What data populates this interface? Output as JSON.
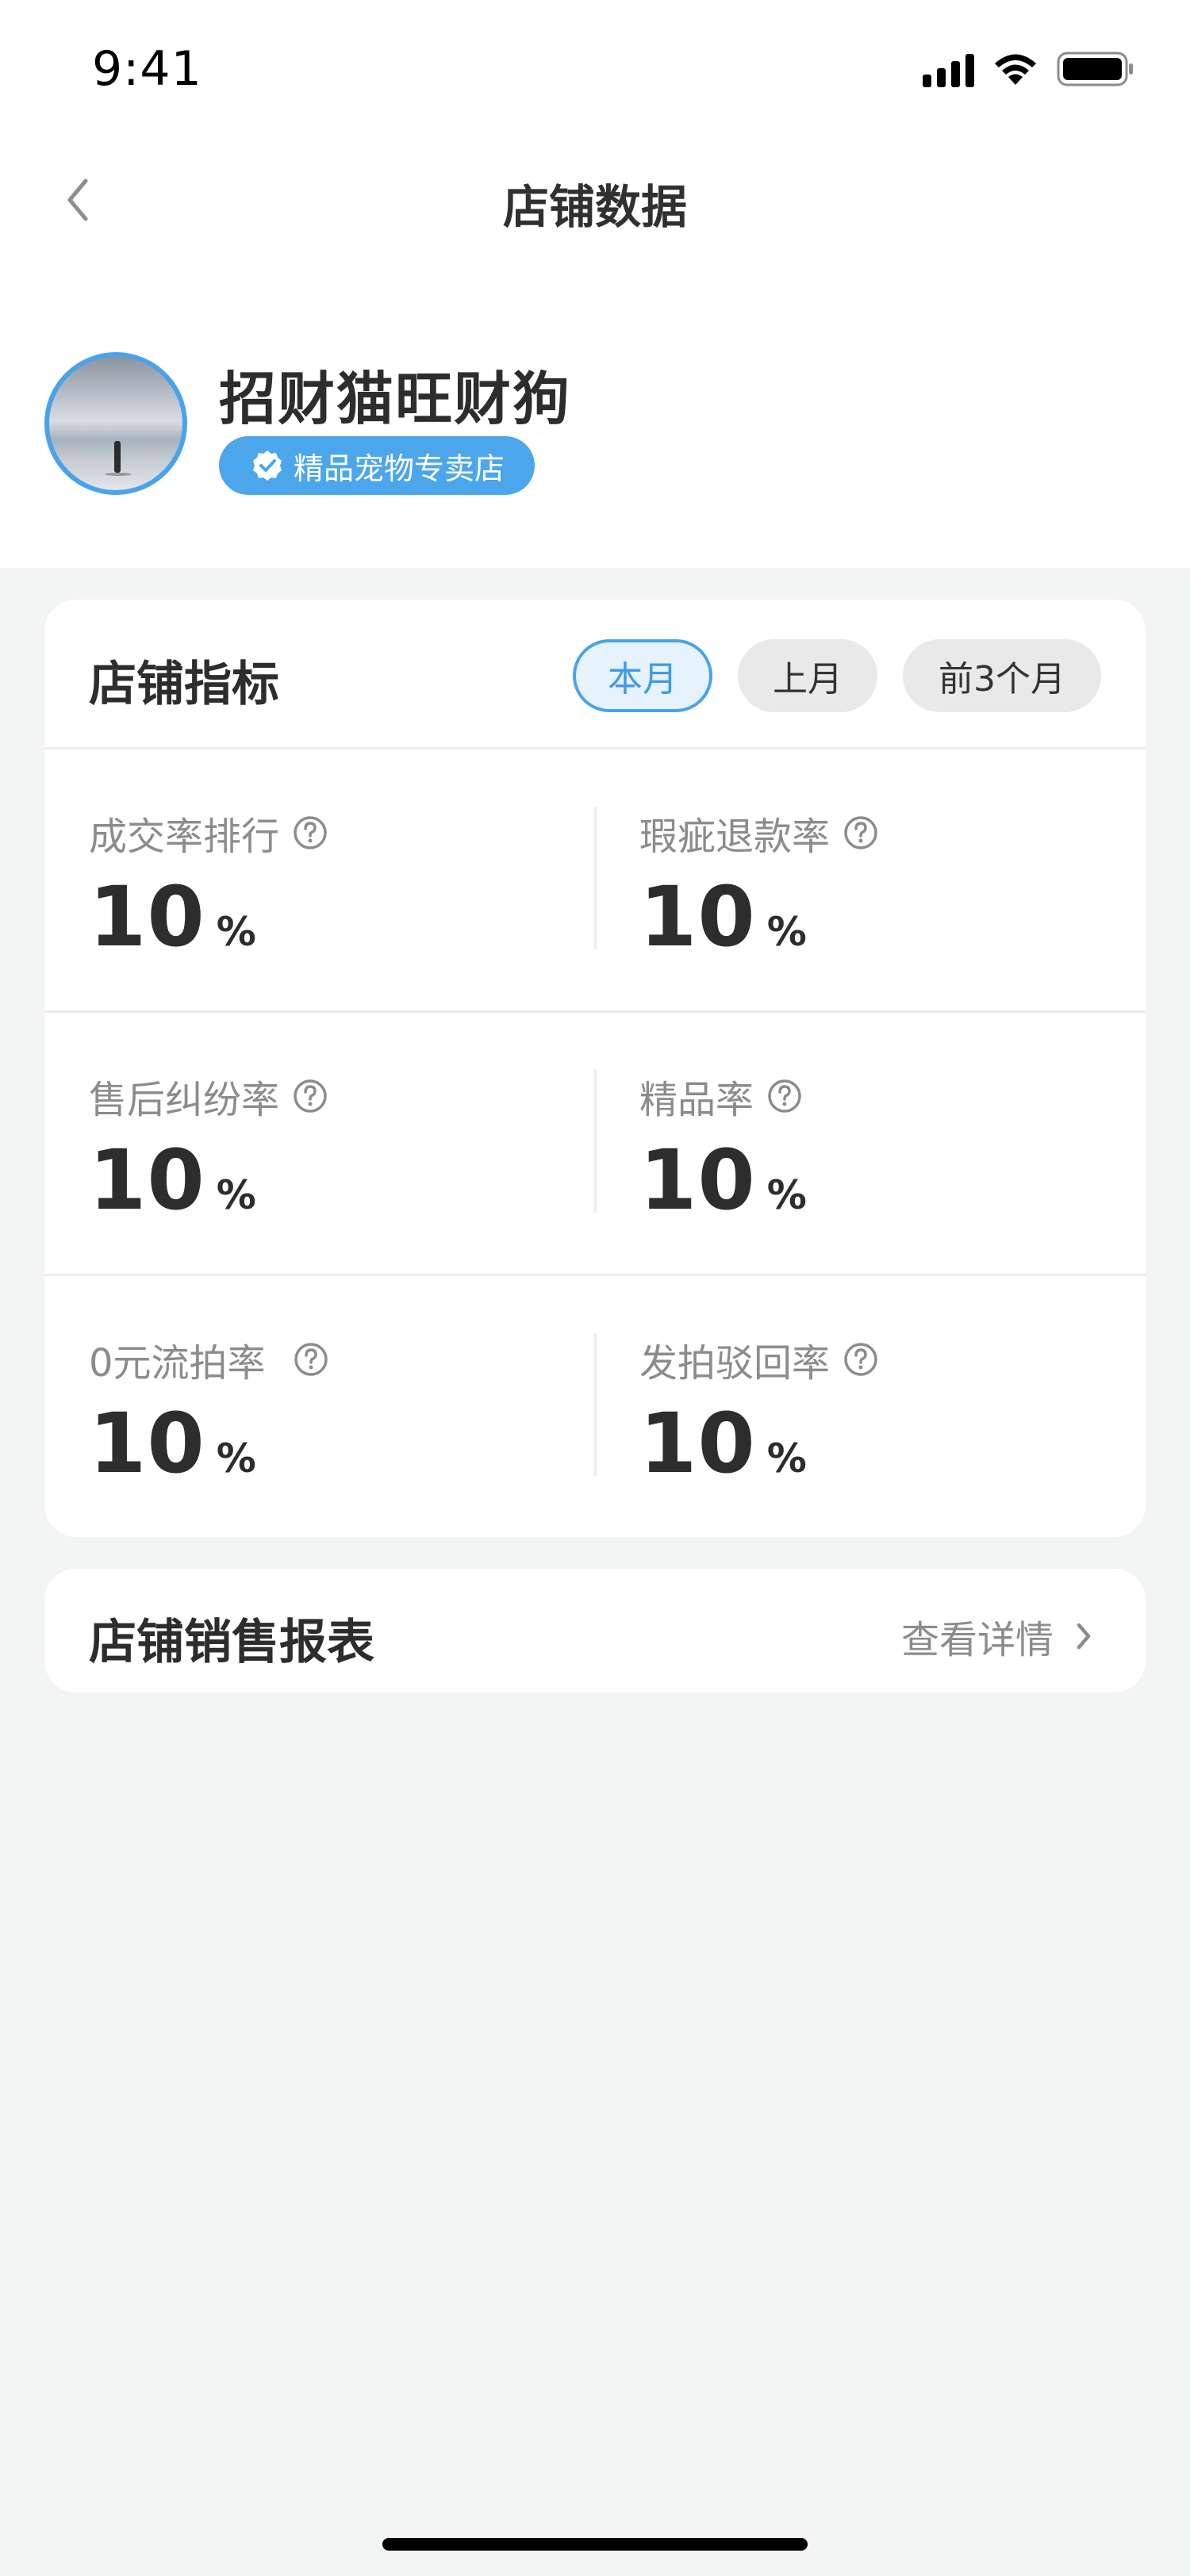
{
  "status_bar": {
    "time": "9:41"
  },
  "nav": {
    "title": "店铺数据",
    "back_icon": "chevron-left-icon"
  },
  "shop": {
    "name": "招财猫旺财狗",
    "badge": "精品宠物专卖店",
    "badge_icon": "verified-check-icon"
  },
  "metrics": {
    "title": "店铺指标",
    "tabs": [
      {
        "label": "本月",
        "active": true
      },
      {
        "label": "上月",
        "active": false
      },
      {
        "label": "前3个月",
        "active": false
      }
    ],
    "items": [
      {
        "label": "成交率排行",
        "value": "10",
        "unit": "%"
      },
      {
        "label": "瑕疵退款率",
        "value": "10",
        "unit": "%"
      },
      {
        "label": "售后纠纷率",
        "value": "10",
        "unit": "%"
      },
      {
        "label": "精品率",
        "value": "10",
        "unit": "%"
      },
      {
        "label": "0元流拍率",
        "value": "10",
        "unit": "%"
      },
      {
        "label": "发拍驳回率",
        "value": "10",
        "unit": "%"
      }
    ]
  },
  "report": {
    "title": "店铺销售报表",
    "link_label": "查看详情"
  },
  "colors": {
    "accent": "#4aa3ea",
    "background": "#f3f4f4",
    "card": "#ffffff",
    "text_primary": "#2d2d2d",
    "text_secondary": "#8c8c8c"
  }
}
